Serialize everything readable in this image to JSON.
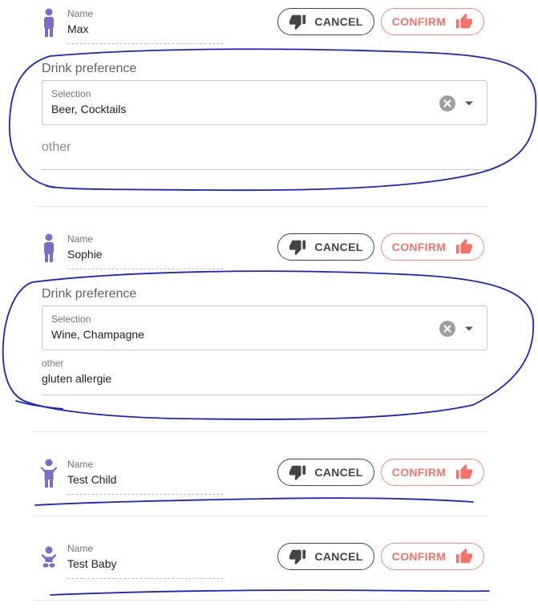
{
  "guests": [
    {
      "name_label": "Name",
      "name": "Max",
      "icon": "adult-person-icon",
      "cancel_label": "CANCEL",
      "confirm_label": "CONFIRM",
      "drink_title": "Drink preference",
      "selection_label": "Selection",
      "selection_value": "Beer, Cocktails",
      "other_placeholder": "other"
    },
    {
      "name_label": "Name",
      "name": "Sophie",
      "icon": "adult-person-icon",
      "cancel_label": "CANCEL",
      "confirm_label": "CONFIRM",
      "drink_title": "Drink preference",
      "selection_label": "Selection",
      "selection_value": "Wine, Champagne",
      "other_label": "other",
      "other_value": "gluten allergie"
    },
    {
      "name_label": "Name",
      "name": "Test Child",
      "icon": "child-icon",
      "cancel_label": "CANCEL",
      "confirm_label": "CONFIRM"
    },
    {
      "name_label": "Name",
      "name": "Test Baby",
      "icon": "baby-icon",
      "cancel_label": "CANCEL",
      "confirm_label": "CONFIRM"
    }
  ],
  "colors": {
    "person_icon": "#7e6bc4",
    "cancel_border": "#444444",
    "confirm_text": "#f0746a",
    "confirm_border": "#f28b82",
    "annotation_ink": "#1a24c8"
  }
}
